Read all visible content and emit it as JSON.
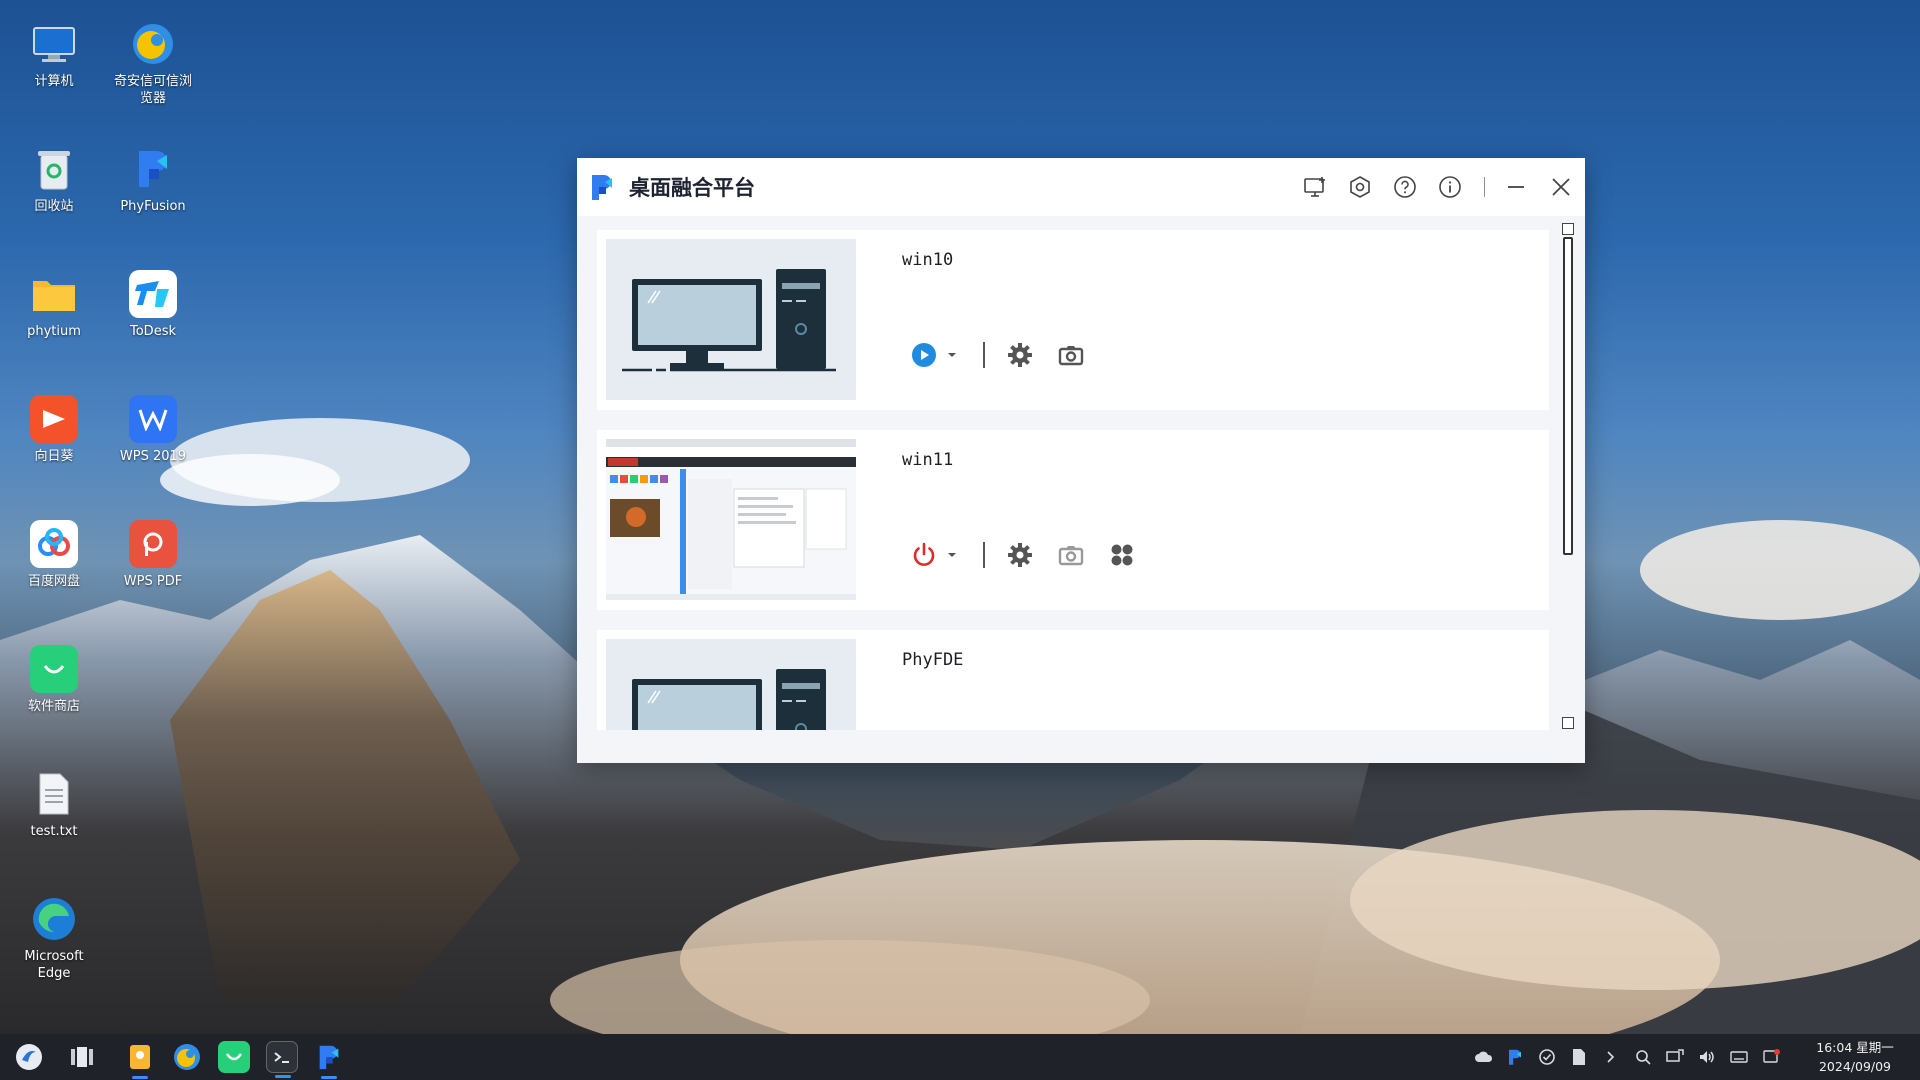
{
  "desktop": {
    "icons": [
      {
        "label": "计算机",
        "icon": "computer-icon"
      },
      {
        "label": "奇安信可信浏览器",
        "icon": "qianxin-browser-icon"
      },
      {
        "label": "回收站",
        "icon": "recycle-bin-icon"
      },
      {
        "label": "PhyFusion",
        "icon": "phyfusion-icon"
      },
      {
        "label": "phytium",
        "icon": "folder-icon"
      },
      {
        "label": "ToDesk",
        "icon": "todesk-icon"
      },
      {
        "label": "向日葵",
        "icon": "sunlogin-icon"
      },
      {
        "label": "WPS 2019",
        "icon": "wps-icon"
      },
      {
        "label": "百度网盘",
        "icon": "baidu-netdisk-icon"
      },
      {
        "label": "WPS PDF",
        "icon": "wps-pdf-icon"
      },
      {
        "label": "软件商店",
        "icon": "software-store-icon"
      },
      {
        "label": "test.txt",
        "icon": "text-file-icon"
      },
      {
        "label": "Microsoft Edge",
        "icon": "edge-icon"
      }
    ]
  },
  "window": {
    "title": "桌面融合平台",
    "toolbar": [
      "add-desktop-icon",
      "settings-icon",
      "help-icon",
      "info-icon",
      "minimize-icon",
      "close-icon"
    ]
  },
  "vms": [
    {
      "name": "win10",
      "state": "stopped",
      "power_color": "#1f8ce0"
    },
    {
      "name": "win11",
      "state": "running",
      "power_color": "#e02b2b"
    },
    {
      "name": "PhyFDE",
      "state": "stopped",
      "power_color": "#1f8ce0"
    }
  ],
  "taskbar": {
    "apps": [
      "start-menu-icon",
      "task-view-icon",
      "files-icon",
      "browser-icon",
      "software-store-icon",
      "terminal-icon",
      "phyfusion-icon"
    ],
    "tray": [
      "cloud-icon",
      "phyfusion-tray-icon",
      "check-icon",
      "document-icon",
      "chevron-right-icon",
      "search-icon",
      "screen-share-icon",
      "volume-icon",
      "keyboard-icon",
      "notification-icon"
    ],
    "time": "16:04 星期一",
    "date": "2024/09/09"
  }
}
